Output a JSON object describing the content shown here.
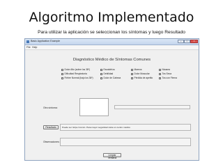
{
  "slide": {
    "title": "Algoritmo Implementado",
    "subtitle": "Para utilizar la aplicación se seleccionan los síntomas y luego Resultado"
  },
  "window": {
    "title": "Basic Application Example",
    "menu": [
      "File",
      "Help"
    ],
    "controls": {
      "minimize": "–",
      "maximize": "□",
      "close": "×"
    }
  },
  "app": {
    "heading": "Diagnóstico Médico de Síntomas Comunes",
    "symptoms": [
      [
        "Dolor Alto (sobre los 38º)",
        "Escalofríos",
        "Mareos",
        "Náusea"
      ],
      [
        "Dificultad Respiratoria",
        "Debilidad",
        "Dolor Muscular",
        "Tos Seca"
      ],
      [
        "Fiebre Normal (bajo los 38º)",
        "Dolor de Cabeza",
        "Pérdida de apetito",
        "Tos con Flema"
      ]
    ],
    "checked": [
      false,
      false,
      false,
      false,
      false,
      false,
      false,
      false,
      false,
      false,
      false,
      false
    ],
    "otros_label": "Otro síntoma:",
    "resultado_button": "Resultado",
    "resultado_text": "Puede ser Gripe Común. Para mayor seguridad visite un centro médico",
    "observaciones_label": "Observaciones:",
    "limpiar_button": "Limpiar Ventana"
  }
}
